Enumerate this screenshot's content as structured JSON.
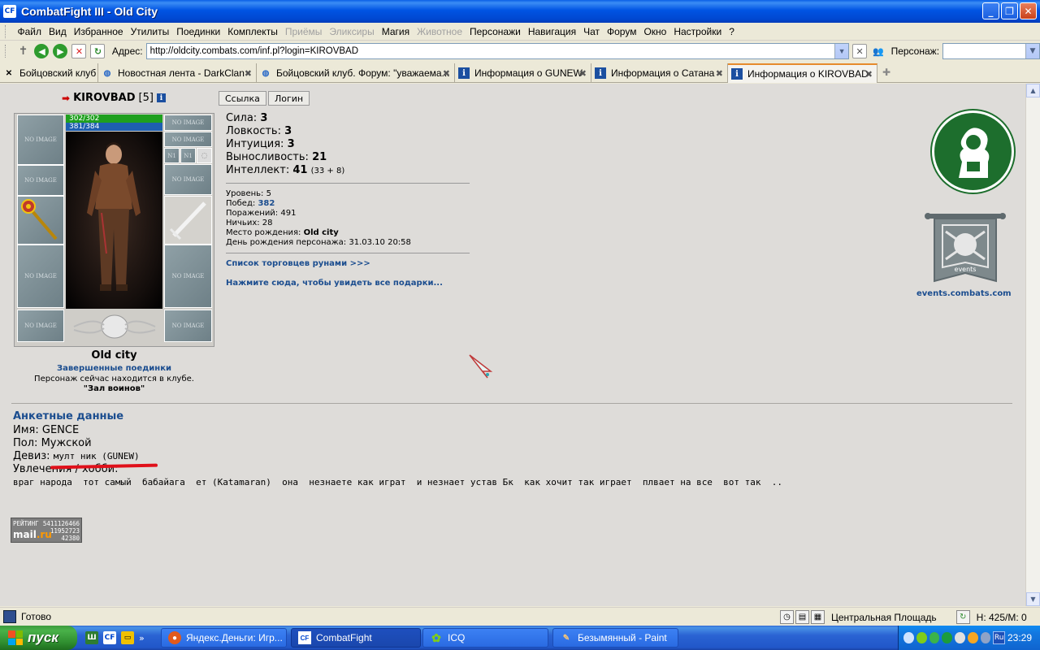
{
  "window": {
    "title": "CombatFight III - Old City",
    "app_icon": "CF"
  },
  "menu": [
    "Файл",
    "Вид",
    "Избранное",
    "Утилиты",
    "Поединки",
    "Комплекты",
    "Приёмы",
    "Эликсиры",
    "Магия",
    "Животное",
    "Персонажи",
    "Навигация",
    "Чат",
    "Форум",
    "Окно",
    "Настройки",
    "?"
  ],
  "menu_disabled": [
    "Приёмы",
    "Эликсиры",
    "Животное"
  ],
  "address": {
    "label": "Адрес:",
    "url": "http://oldcity.combats.com/inf.pl?login=KIROVBAD"
  },
  "person": {
    "label": "Персонаж:",
    "value": ""
  },
  "tabs": [
    {
      "label": "Бойцовский клуб",
      "icon": "crossed-swords-icon"
    },
    {
      "label": "Новостная лента - DarkClan",
      "icon": "globe-icon"
    },
    {
      "label": "Бойцовский клуб. Форум: \"уважаема...",
      "icon": "globe-icon"
    },
    {
      "label": "Информация о GUNEW",
      "icon": "info-icon"
    },
    {
      "label": "Информация о Сатана",
      "icon": "info-icon"
    },
    {
      "label": "Информация о KIROVBAD",
      "icon": "info-icon",
      "active": true
    }
  ],
  "character": {
    "name": "KIROVBAD",
    "level": "[5]",
    "hp": "302/302",
    "mana": "381/384",
    "no_image": "NO IMAGE",
    "small_slot": "N1",
    "city": "Old city",
    "fights_link": "Завершенные поединки",
    "club_note": "Персонаж сейчас находится в клубе.",
    "club_room": "\"Зал воинов\""
  },
  "buttons": {
    "link": "Ссылка",
    "login": "Логин"
  },
  "stats": {
    "strength_label": "Сила:",
    "strength": "3",
    "agility_label": "Ловкость:",
    "agility": "3",
    "intuition_label": "Интуиция:",
    "intuition": "3",
    "endurance_label": "Выносливость:",
    "endurance": "21",
    "intellect_label": "Интеллект:",
    "intellect": "41",
    "intellect_extra": "(33 + 8)"
  },
  "details": {
    "level_label": "Уровень:",
    "level": "5",
    "wins_label": "Побед:",
    "wins": "382",
    "losses_label": "Поражений:",
    "losses": "491",
    "draws_label": "Ничьих:",
    "draws": "28",
    "birthplace_label": "Место рождения:",
    "birthplace": "Old city",
    "birthday_label": "День рождения персонажа:",
    "birthday": "31.03.10 20:58"
  },
  "links": {
    "rune_traders": "Список торговцев рунами >>>",
    "gifts": "Нажмите сюда, чтобы увидеть все подарки...",
    "events": "events.combats.com",
    "banner_text": "events"
  },
  "profile": {
    "title": "Анкетные данные",
    "name_label": "Имя:",
    "name": "GENCE",
    "gender_label": "Пол:",
    "gender": "Мужской",
    "motto_label": "Девиз:",
    "motto": "мулт ник (GUNEW)",
    "hobby_label": "Увлечения / хобби:",
    "hobby": "враг народа  тот самый  бабайага  ет (Katamaran)  она  незнаете как играт  и незнает устав Бк  как хочит так играет  плвает на все  вот так  .."
  },
  "rating": {
    "label": "РЕЙТИНГ",
    "n1": "5411126466",
    "n2": "11952723",
    "n3": "42380",
    "brand_a": "mail",
    "brand_b": ".ru"
  },
  "status": {
    "text": "Готово",
    "location": "Центральная Площадь",
    "hm": "H: 425/M: 0"
  },
  "taskbar": {
    "start": "пуск",
    "tasks": [
      "Яндекс.Деньги: Игр...",
      "CombatFight",
      "ICQ",
      "Безымянный - Paint"
    ],
    "lang": "Ru",
    "clock": "23:29"
  },
  "colors": {
    "link_blue": "#1b4d8f",
    "underline_red": "#e0101a",
    "clan_green": "#1d6e2d"
  }
}
